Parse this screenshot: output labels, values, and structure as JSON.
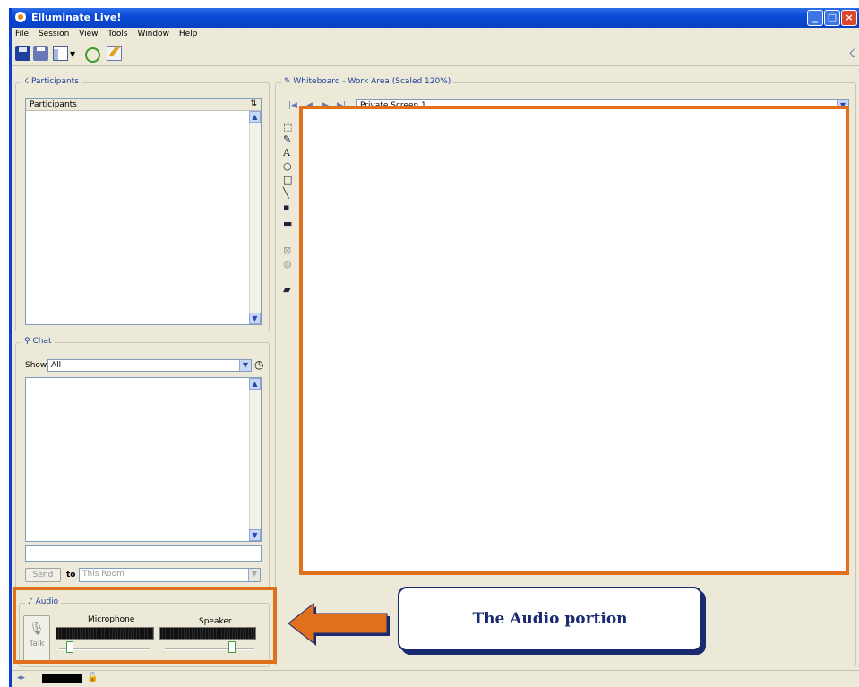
{
  "window": {
    "title": "Elluminate Live!"
  },
  "menu": [
    "File",
    "Session",
    "View",
    "Tools",
    "Window",
    "Help"
  ],
  "participants": {
    "group_title": "Participants",
    "column_header": "Participants",
    "sort_icon": "⇅"
  },
  "chat": {
    "group_title": "Chat",
    "show_label": "Show",
    "show_value": "All",
    "send_label": "Send",
    "to_label": "to",
    "to_value": "This Room"
  },
  "whiteboard": {
    "title": "Whiteboard - Work Area (Scaled 120%)",
    "screen_value": "Private Screen 1"
  },
  "audio": {
    "group_title": "Audio",
    "talk_label": "Talk",
    "microphone_label": "Microphone",
    "speaker_label": "Speaker",
    "microphone_level": 0.12,
    "speaker_level": 0.75
  },
  "callout": {
    "text": "The Audio portion"
  },
  "colors": {
    "highlight": "#e0701c",
    "titlebar": "#0a4ad8",
    "callout_text": "#1a2a70"
  },
  "icons": [
    "save-icon",
    "print-icon",
    "layout-icon",
    "refresh-icon",
    "edit-icon",
    "connection-icon",
    "microphone-icon",
    "speaker-icon"
  ]
}
